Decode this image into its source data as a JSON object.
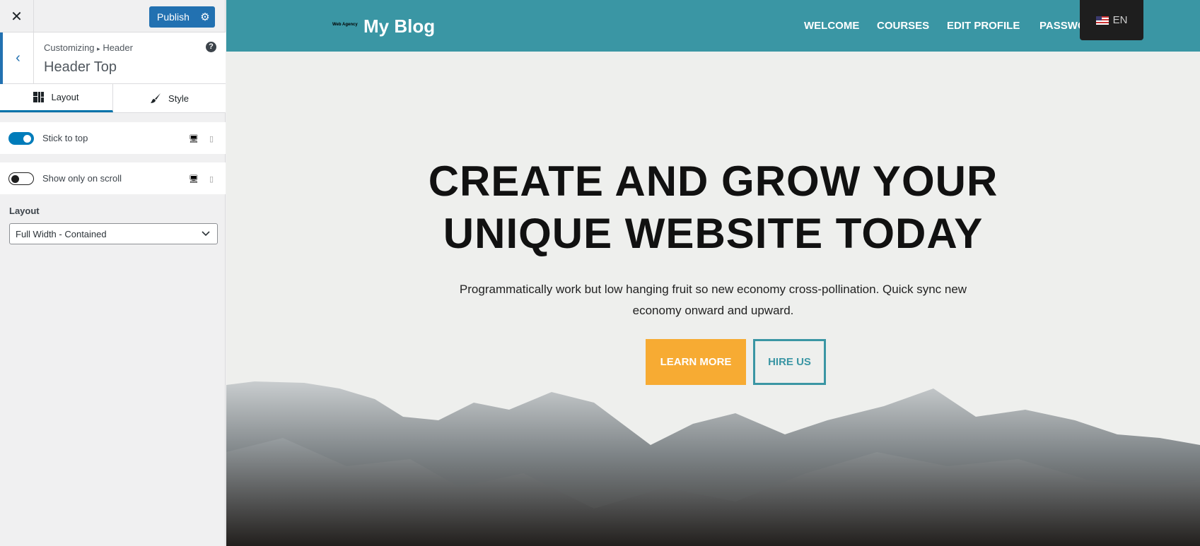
{
  "sidebar": {
    "close_icon": "close-icon",
    "publish_label": "Publish",
    "breadcrumb": {
      "root": "Customizing",
      "separator": "▸",
      "parent": "Header"
    },
    "section_title": "Header Top",
    "tabs": [
      {
        "label": "Layout",
        "icon": "layout-icon",
        "active": true
      },
      {
        "label": "Style",
        "icon": "brush-icon",
        "active": false
      }
    ],
    "toggles": [
      {
        "label": "Stick to top",
        "on": true
      },
      {
        "label": "Show only on scroll",
        "on": false
      }
    ],
    "layout_label": "Layout",
    "layout_value": "Full Width - Contained"
  },
  "preview": {
    "logo_text": "Web Agency",
    "site_title": "My Blog",
    "nav": [
      "WELCOME",
      "COURSES",
      "EDIT PROFILE",
      "PASSWORD"
    ],
    "language": "EN",
    "hero_title": [
      "CREATE AND GROW YOUR",
      "UNIQUE WEBSITE TODAY"
    ],
    "hero_text": [
      "Programmatically work but low hanging fruit so new economy cross-pollination. Quick sync new",
      "economy onward and upward."
    ],
    "learn_more": "LEARN MORE",
    "hire_us": "HIRE US",
    "colors": {
      "header": "#3a96a4",
      "accent": "#f7ab33",
      "admin_blue": "#2271b1"
    }
  }
}
